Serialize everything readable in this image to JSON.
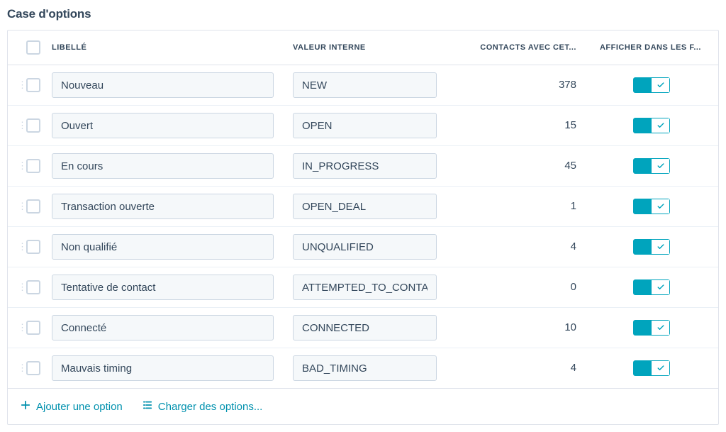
{
  "section": {
    "title": "Case d'options"
  },
  "columns": {
    "label": "LIBELLÉ",
    "internal": "VALEUR INTERNE",
    "contacts": "CONTACTS AVEC CET...",
    "visible": "AFFICHER DANS LES F..."
  },
  "rows": [
    {
      "label": "Nouveau",
      "internal": "NEW",
      "contacts": "378"
    },
    {
      "label": "Ouvert",
      "internal": "OPEN",
      "contacts": "15"
    },
    {
      "label": "En cours",
      "internal": "IN_PROGRESS",
      "contacts": "45"
    },
    {
      "label": "Transaction ouverte",
      "internal": "OPEN_DEAL",
      "contacts": "1"
    },
    {
      "label": "Non qualifié",
      "internal": "UNQUALIFIED",
      "contacts": "4"
    },
    {
      "label": "Tentative de contact",
      "internal": "ATTEMPTED_TO_CONTAC",
      "contacts": "0"
    },
    {
      "label": "Connecté",
      "internal": "CONNECTED",
      "contacts": "10"
    },
    {
      "label": "Mauvais timing",
      "internal": "BAD_TIMING",
      "contacts": "4"
    }
  ],
  "footer": {
    "add": "Ajouter une option",
    "load": "Charger des options..."
  }
}
